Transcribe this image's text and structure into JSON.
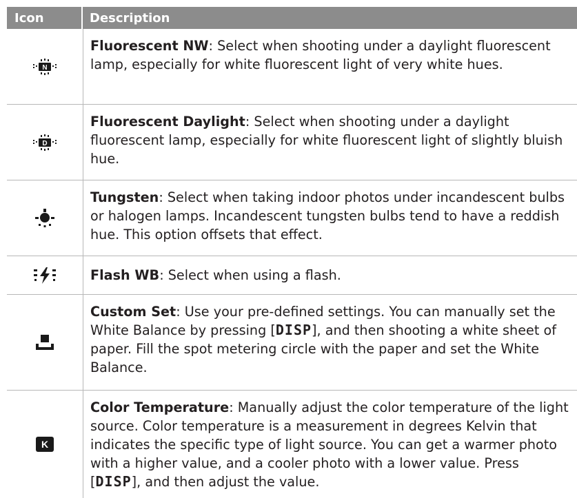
{
  "header": {
    "icon_col": "Icon",
    "desc_col": "Description"
  },
  "disp_label": "DISP",
  "rows": [
    {
      "icon": "fluorescent-nw-icon",
      "title": "Fluorescent NW",
      "text": ": Select when shooting under a daylight fluorescent lamp, especially for white fluorescent light of very white hues."
    },
    {
      "icon": "fluorescent-daylight-icon",
      "title": "Fluorescent Daylight",
      "text": ": Select when shooting under a daylight fluorescent lamp, especially for white fluorescent light of slightly bluish hue."
    },
    {
      "icon": "tungsten-icon",
      "title": "Tungsten",
      "text": ": Select when taking indoor photos under incandescent bulbs or halogen lamps. Incandescent tungsten bulbs tend to have a reddish hue. This option offsets that effect."
    },
    {
      "icon": "flash-wb-icon",
      "title": "Flash WB",
      "text": ": Select when using a flash."
    },
    {
      "icon": "custom-set-icon",
      "title": "Custom Set",
      "text_a": ": Use your pre-defined settings. You can manually set the White Balance by pressing [",
      "text_b": "], and then shooting a white sheet of paper. Fill the spot metering circle with the paper and set the White Balance."
    },
    {
      "icon": "kelvin-icon",
      "icon_letter": "K",
      "title": "Color Temperature",
      "text_a": ": Manually adjust the color temperature of the light source. Color temperature is a measurement in degrees Kelvin that indicates the specific type of light source. You can get a warmer photo with a higher value, and a cooler photo with a lower value. Press [",
      "text_b": "], and then adjust the value."
    }
  ]
}
